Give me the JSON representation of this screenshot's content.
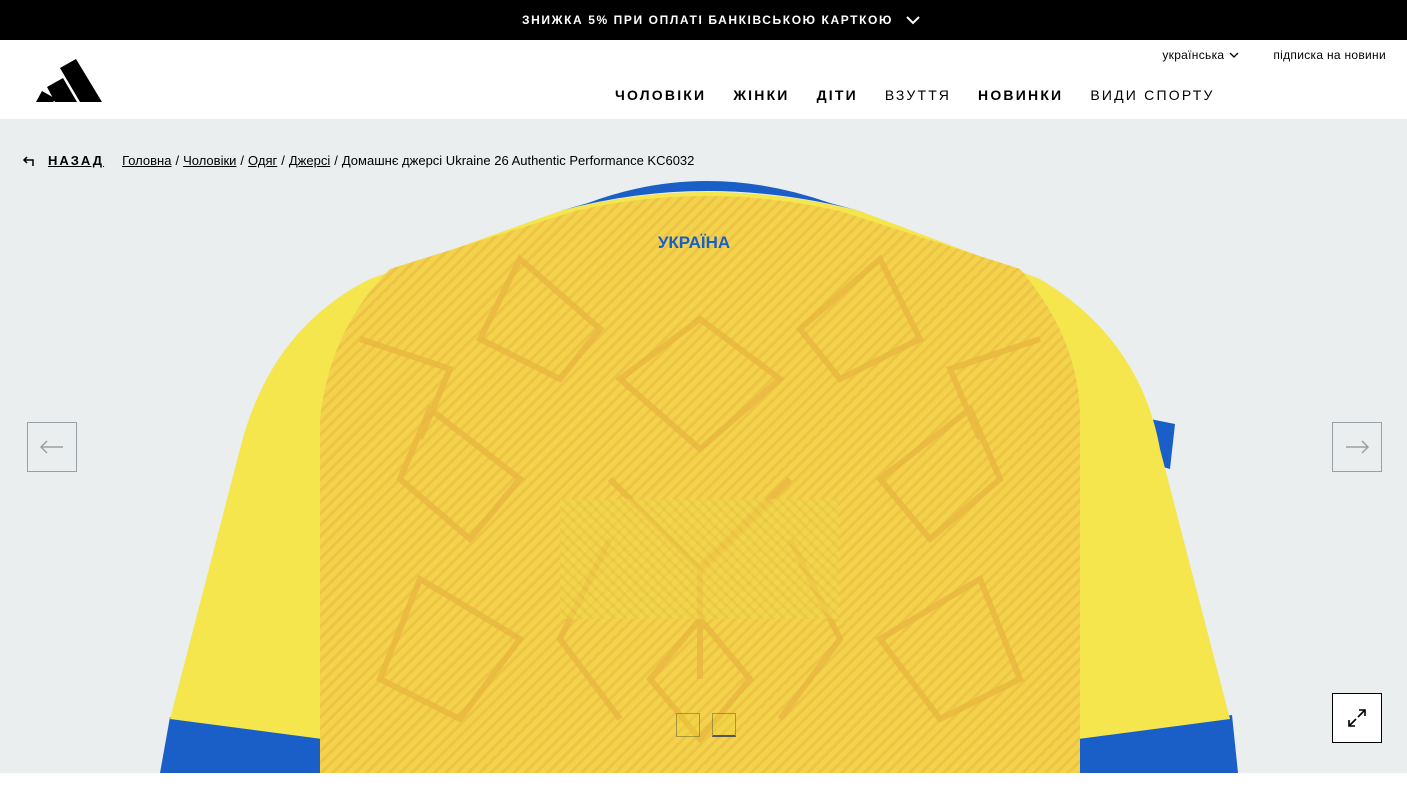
{
  "promo": {
    "text": "ЗНИЖКА 5% ПРИ ОПЛАТІ БАНКІВСЬКОЮ КАРТКОЮ",
    "icon": "chevron-down-icon"
  },
  "header": {
    "logo_icon": "adidas-logo",
    "language": "українська",
    "newsletter": "підписка на новини",
    "nav": [
      {
        "label": "ЧОЛОВІКИ",
        "weight": "bold"
      },
      {
        "label": "ЖІНКИ",
        "weight": "bold"
      },
      {
        "label": "ДІТИ",
        "weight": "bold"
      },
      {
        "label": "ВЗУТТЯ",
        "weight": "light"
      },
      {
        "label": "НОВИНКИ",
        "weight": "bold"
      },
      {
        "label": "ВИДИ СПОРТУ",
        "weight": "light"
      }
    ]
  },
  "breadcrumb": {
    "back": "НАЗАД",
    "links": [
      "Головна",
      "Чоловіки",
      "Одяг",
      "Джерсі"
    ],
    "separator": "/",
    "current": "Домашнє джерсі Ukraine 26 Authentic Performance KC6032"
  },
  "gallery": {
    "jersey_label": "УКРАЇНА",
    "prev_icon": "arrow-left-icon",
    "next_icon": "arrow-right-icon",
    "zoom_icon": "expand-icon",
    "thumbnails_count": 2,
    "active_thumbnail": 2
  },
  "colors": {
    "stage_bg": "#eaeeef",
    "jersey_yellow": "#f2e44a",
    "jersey_pattern": "#ecc24a",
    "jersey_blue": "#1a5fc8",
    "promo_bg": "#000000"
  }
}
